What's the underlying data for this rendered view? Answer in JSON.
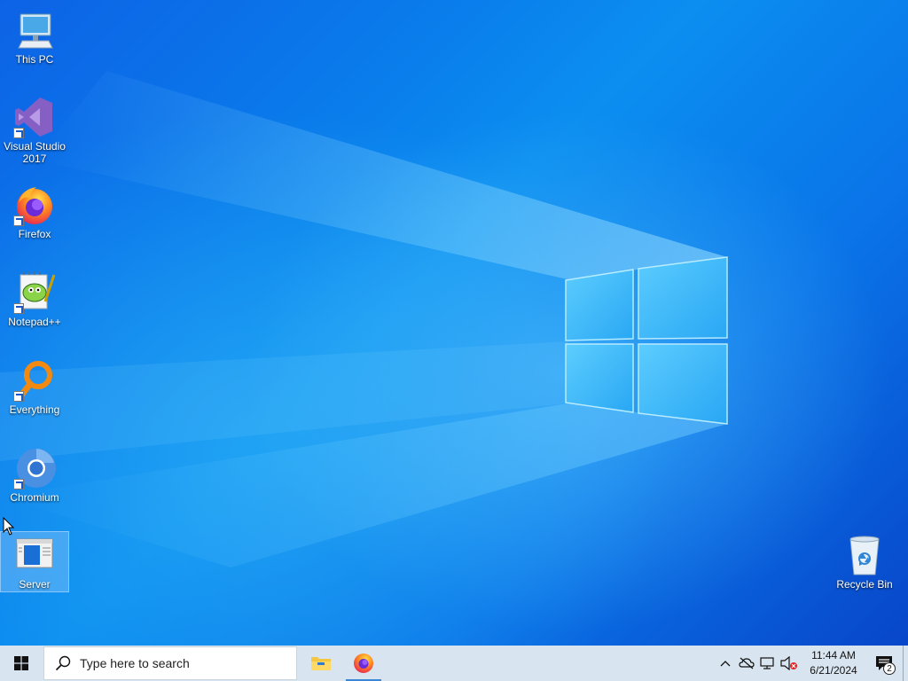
{
  "desktop": {
    "icons": [
      {
        "label": "This PC",
        "icon": "this-pc-icon",
        "shortcut": false
      },
      {
        "label": "Visual Studio 2017",
        "icon": "visual-studio-icon",
        "shortcut": true
      },
      {
        "label": "Firefox",
        "icon": "firefox-icon",
        "shortcut": true
      },
      {
        "label": "Notepad++",
        "icon": "notepad-plus-plus-icon",
        "shortcut": true
      },
      {
        "label": "Everything",
        "icon": "everything-search-icon",
        "shortcut": true
      },
      {
        "label": "Chromium",
        "icon": "chromium-icon",
        "shortcut": true
      },
      {
        "label": "Server",
        "icon": "server-window-icon",
        "shortcut": false,
        "selected": true
      }
    ],
    "recycle_bin": {
      "label": "Recycle Bin",
      "icon": "recycle-bin-icon"
    }
  },
  "taskbar": {
    "search_placeholder": "Type here to search",
    "pinned": [
      {
        "name": "File Explorer",
        "icon": "file-explorer-icon",
        "active": false
      },
      {
        "name": "Firefox",
        "icon": "firefox-icon",
        "active": true
      }
    ],
    "tray": {
      "icons": [
        "chevron-up-icon",
        "onedrive-offline-icon",
        "network-icon",
        "volume-muted-icon"
      ],
      "time": "11:44 AM",
      "date": "6/21/2024",
      "notification_count": "2"
    }
  },
  "colors": {
    "taskbar_bg": "#d8e4ef",
    "accent": "#3b86d6",
    "wallpaper_blue": "#0a78ea"
  }
}
